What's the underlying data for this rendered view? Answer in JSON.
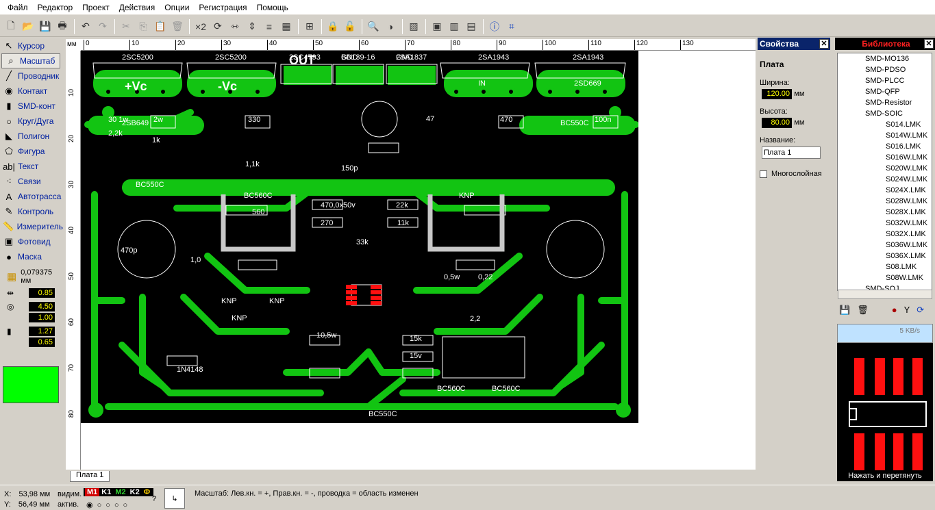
{
  "menu": [
    "Файл",
    "Редактор",
    "Проект",
    "Действия",
    "Опции",
    "Регистрация",
    "Помощь"
  ],
  "tools": [
    {
      "label": "Курсор",
      "icon": "cursor-icon",
      "glyph": "↖"
    },
    {
      "label": "Масштаб",
      "icon": "zoom-icon",
      "glyph": "⌕"
    },
    {
      "label": "Проводник",
      "icon": "track-icon",
      "glyph": "╱"
    },
    {
      "label": "Контакт",
      "icon": "pad-icon",
      "glyph": "◉"
    },
    {
      "label": "SMD-конт",
      "icon": "smd-pad-icon",
      "glyph": "▮"
    },
    {
      "label": "Круг/Дуга",
      "icon": "circle-icon",
      "glyph": "○"
    },
    {
      "label": "Полигон",
      "icon": "polygon-icon",
      "glyph": "◣"
    },
    {
      "label": "Фигура",
      "icon": "shape-icon",
      "glyph": "⬠"
    },
    {
      "label": "Текст",
      "icon": "text-icon",
      "glyph": "ab|"
    },
    {
      "label": "Связи",
      "icon": "connections-icon",
      "glyph": "⁖"
    },
    {
      "label": "Автотрасса",
      "icon": "autoroute-icon",
      "glyph": "A"
    },
    {
      "label": "Контроль",
      "icon": "check-icon",
      "glyph": "✎"
    },
    {
      "label": "Измеритель",
      "icon": "measure-icon",
      "glyph": "📏"
    },
    {
      "label": "Фотовид",
      "icon": "photoview-icon",
      "glyph": "▣"
    },
    {
      "label": "Маска",
      "icon": "mask-icon",
      "glyph": "●"
    }
  ],
  "grid": "0,079375 мм",
  "params": [
    "0.85",
    "4.50",
    "1.00",
    "1.27",
    "0.65"
  ],
  "ruler_unit": "мм",
  "ruler_top": [
    "0",
    "10",
    "20",
    "30",
    "40",
    "50",
    "60",
    "70",
    "80",
    "90",
    "100",
    "110",
    "120",
    "130"
  ],
  "ruler_left": [
    "10",
    "20",
    "30",
    "40",
    "50",
    "60",
    "70",
    "80"
  ],
  "board_tab": "Плата 1",
  "properties": {
    "title": "Свойства",
    "section": "Плата",
    "width_label": "Ширина:",
    "width": "120.00",
    "height_label": "Высота:",
    "height": "80.00",
    "unit": "мм",
    "name_label": "Название:",
    "name": "Плата 1",
    "multilayer": "Многослойная"
  },
  "library": {
    "title": "Библиотека",
    "items": [
      "SMD-MO136",
      "SMD-PDSO",
      "SMD-PLCC",
      "SMD-QFP",
      "SMD-Resistor",
      "SMD-SOIC",
      "S014.LMK",
      "S014W.LMK",
      "S016.LMK",
      "S016W.LMK",
      "S020W.LMK",
      "S024W.LMK",
      "S024X.LMK",
      "S028W.LMK",
      "S028X.LMK",
      "S032W.LMK",
      "S032X.LMK",
      "S036W.LMK",
      "S036X.LMK",
      "S08.LMK",
      "S08W.LMK",
      "SMD-SOJ"
    ],
    "speed": "5 KB/s",
    "hint": "Нажать и перетянуть"
  },
  "pcb": {
    "transistors": [
      "2SC5200",
      "2SC5200",
      "2SC4793",
      "BD139-16",
      "2SA1837",
      "2SA1943",
      "2SA1943"
    ],
    "labels": [
      "+Vc",
      "-Vc",
      "OUT",
      "GND",
      "GND",
      "IN",
      "2SD669",
      "2SB649",
      "BC550C",
      "BC550C",
      "BC550C",
      "BC560C",
      "BC560C",
      "BC560C",
      "KNP",
      "KNP",
      "KNP",
      "KNP",
      "0,5w",
      "0,22",
      "2,2",
      "2w",
      "330",
      "470",
      "100n",
      "30 1w",
      "1k",
      "2,2k",
      "1,1k",
      "47",
      "150p",
      "470,0x50v",
      "270",
      "22k",
      "11k",
      "560",
      "33k",
      "470p",
      "1,0",
      "1N4148",
      "10,5w",
      "15k",
      "15v"
    ]
  },
  "status": {
    "x_label": "X:",
    "x": "53,98 мм",
    "y_label": "Y:",
    "y": "56,49 мм",
    "visible": "видим.",
    "active": "актив.",
    "layers": [
      "M1",
      "K1",
      "M2",
      "K2",
      "Ф"
    ],
    "message": "Масштаб: Лев.кн. = +, Прав.кн. = -, проводка = область изменен"
  },
  "colors": {
    "track": "#12c412",
    "board": "#000000",
    "highlight": "#00ff00",
    "smd": "#ff1010"
  }
}
